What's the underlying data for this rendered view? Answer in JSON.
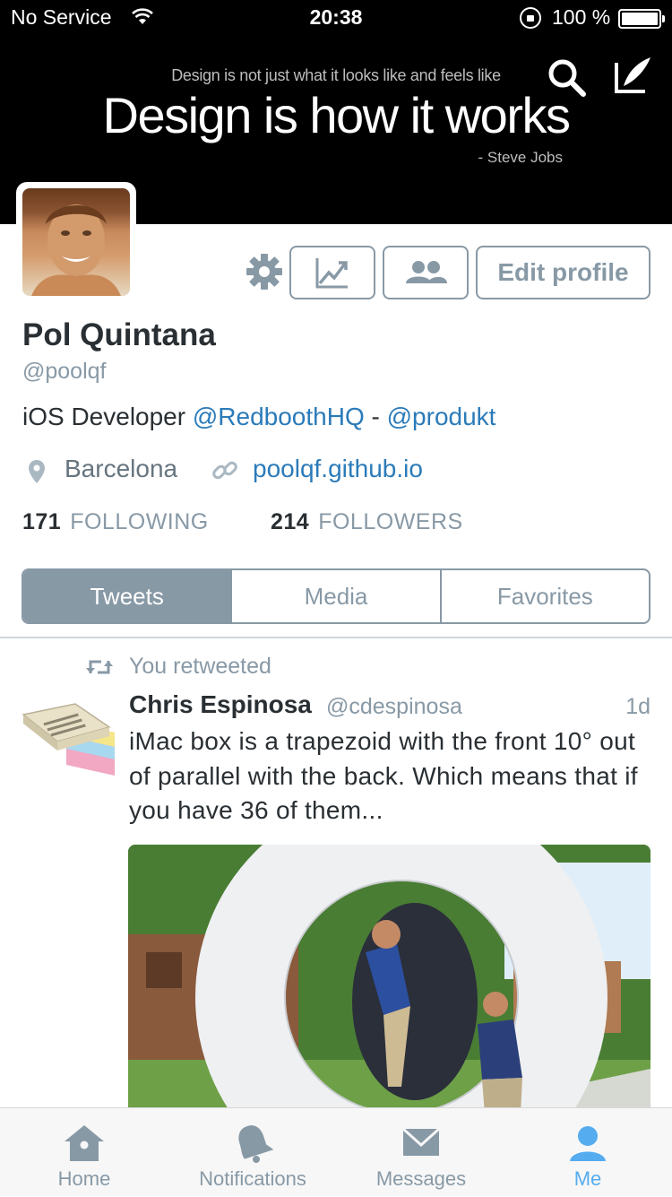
{
  "status_bar": {
    "carrier": "No Service",
    "time": "20:38",
    "battery_percent": "100 %"
  },
  "header": {
    "quote_small": "Design is not just what it looks like and feels like",
    "quote_big": "Design is how it works",
    "quote_author": "- Steve Jobs",
    "icons": [
      "search-icon",
      "compose-icon"
    ]
  },
  "profile": {
    "name": "Pol Quintana",
    "handle": "@poolqf",
    "bio_prefix": "iOS Developer ",
    "bio_mention_1": "@RedboothHQ",
    "bio_separator": " - ",
    "bio_mention_2": "@produkt",
    "location": "Barcelona",
    "website": "poolqf.github.io",
    "following_count": "171",
    "following_label": "FOLLOWING",
    "followers_count": "214",
    "followers_label": "FOLLOWERS",
    "edit_profile_label": "Edit profile"
  },
  "profile_tabs": {
    "tweets": "Tweets",
    "media": "Media",
    "favorites": "Favorites",
    "active": "Tweets"
  },
  "tweet": {
    "retweet_label": "You retweeted",
    "author_name": "Chris Espinosa",
    "author_handle": "@cdespinosa",
    "time": "1d",
    "text": "iMac box is a trapezoid with the front 10° out of parallel with the back. Which means that if you have 36 of them..."
  },
  "tab_bar": {
    "home": "Home",
    "notifications": "Notifications",
    "messages": "Messages",
    "me": "Me",
    "active": "Me"
  },
  "colors": {
    "header_bg": "#000000",
    "link": "#2b7bb9",
    "muted": "#8899a6",
    "active_tab": "#55acee",
    "text": "#292f33"
  }
}
